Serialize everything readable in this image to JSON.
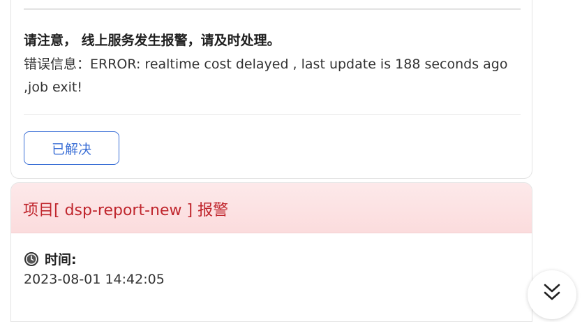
{
  "notice": {
    "title": "请注意， 线上服务发生报警，请及时处理。",
    "error_message": "错误信息：ERROR: realtime cost delayed , last update is 188 seconds ago ,job exit!",
    "resolved_button": "已解决"
  },
  "alert": {
    "title": "项目[ dsp-report-new ] 报警",
    "time_label": "时间:",
    "time_value": "2023-08-01 14:42:05"
  },
  "icons": {
    "clock": "clock-icon",
    "scroll_down": "double-chevron-down-icon"
  },
  "colors": {
    "accent_blue": "#3b6fd6",
    "alert_red": "#c0262d",
    "alert_header_bg": "#fde9ea"
  }
}
